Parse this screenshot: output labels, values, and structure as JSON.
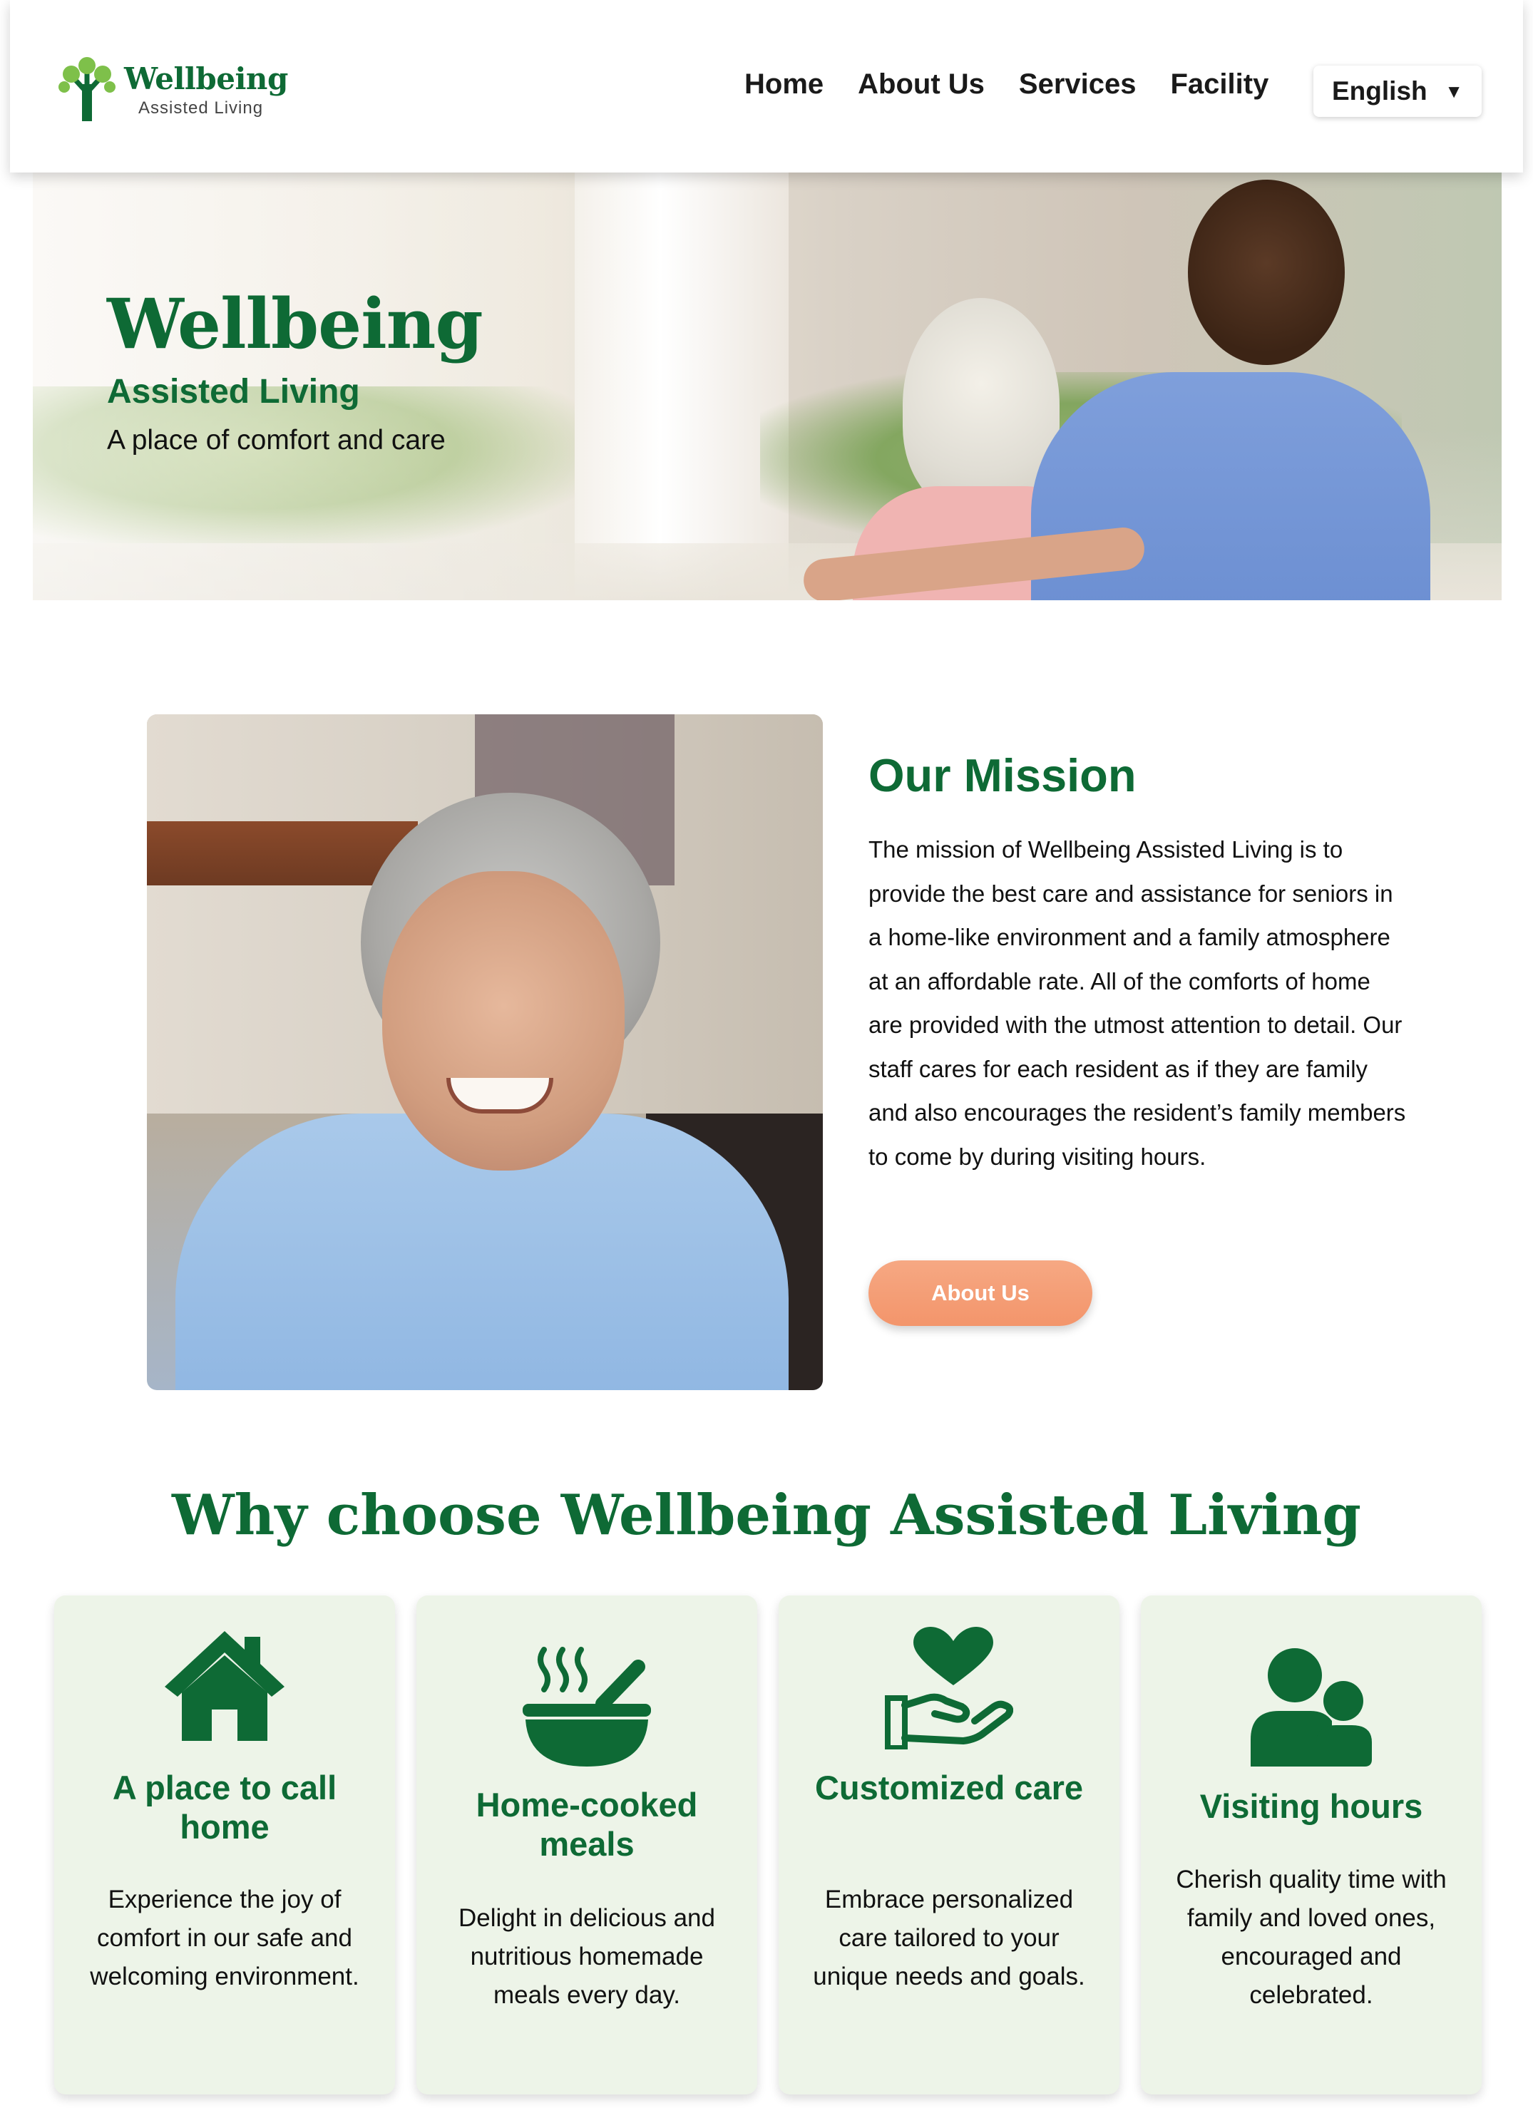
{
  "header": {
    "logo": {
      "name": "Wellbeing",
      "sub": "Assisted Living"
    },
    "nav": [
      "Home",
      "About Us",
      "Services",
      "Facility"
    ],
    "language": {
      "selected": "English",
      "caret": "▼"
    }
  },
  "hero": {
    "title": "Wellbeing",
    "subtitle": "Assisted Living",
    "tagline": "A place of comfort and care"
  },
  "mission": {
    "heading": "Our Mission",
    "body": "The mission of Wellbeing Assisted Living is to provide the best care and assistance for seniors in a home-like environment and a family atmosphere at an affordable rate. All of the comforts of home are provided with the utmost attention to detail. Our staff cares for each resident as if they are family and also encourages the resident’s family members to come by during visiting hours.",
    "button": "About Us"
  },
  "why": {
    "heading": "Why choose Wellbeing Assisted Living",
    "cards": [
      {
        "icon": "house-icon",
        "title": "A place to call home",
        "body": "Experience the joy of comfort in our safe and welcoming environment."
      },
      {
        "icon": "bowl-icon",
        "title": "Home-cooked meals",
        "body": "Delight in delicious and nutritious homemade meals every day."
      },
      {
        "icon": "heart-hand-icon",
        "title": "Customized care",
        "body": "Embrace personalized care tailored to your unique needs and goals."
      },
      {
        "icon": "people-icon",
        "title": "Visiting hours",
        "body": "Cherish quality time with family and loved ones, encouraged and celebrated."
      }
    ]
  },
  "colors": {
    "brand_green": "#0e6a35",
    "card_bg": "#edf4e8",
    "button_orange": "#f3956b"
  }
}
